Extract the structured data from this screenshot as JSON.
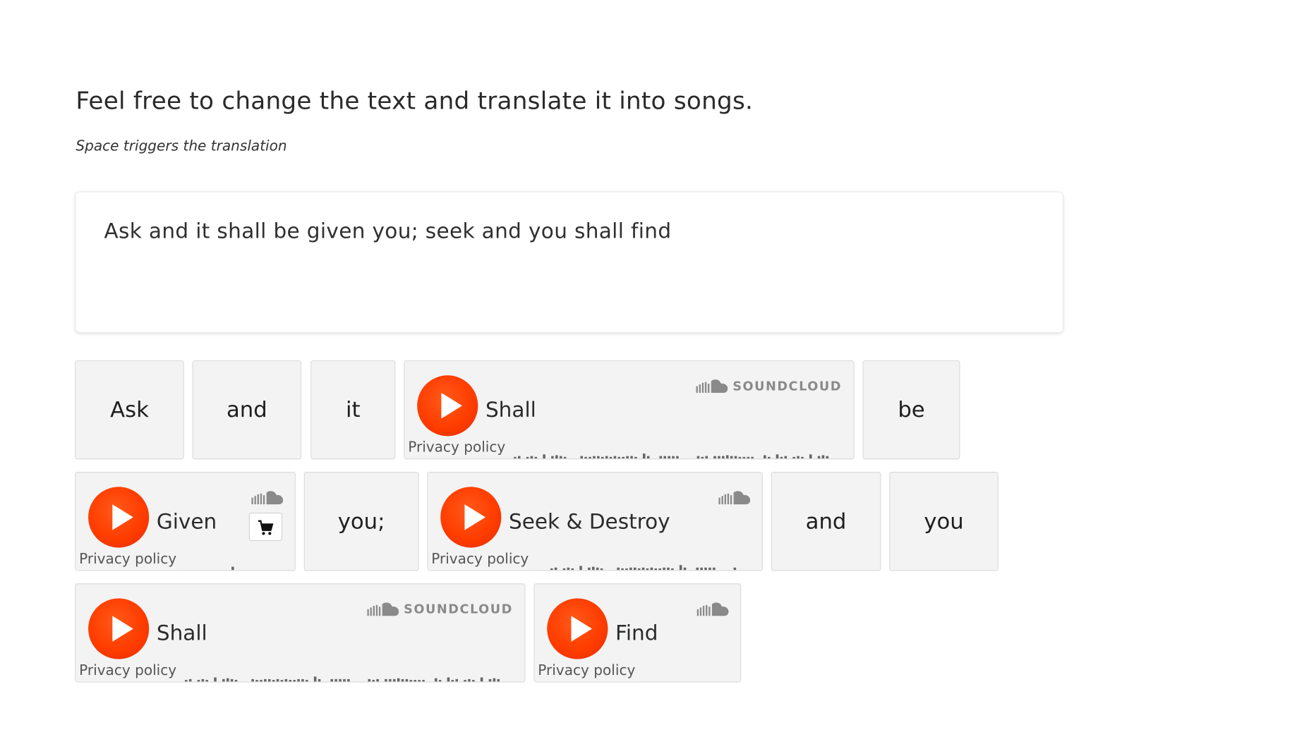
{
  "heading": "Feel free to change the text and translate it into songs.",
  "hint": "Space triggers the translation",
  "editor_text": "Ask and it shall be given you; seek and you shall find",
  "words": {
    "ask": "Ask",
    "and_1": "and",
    "it": "it",
    "be": "be",
    "you_semicolon": "you;",
    "and_2": "and",
    "you": "you"
  },
  "players": {
    "shall_1": {
      "title": "Shall",
      "privacy": "Privacy policy",
      "brand": "SOUNDCLOUD"
    },
    "given": {
      "title": "Given",
      "privacy": "Privacy policy"
    },
    "seek_destroy": {
      "title": "Seek & Destroy",
      "privacy": "Privacy policy"
    },
    "shall_2": {
      "title": "Shall",
      "privacy": "Privacy policy",
      "brand": "SOUNDCLOUD"
    },
    "find": {
      "title": "Find",
      "privacy": "Privacy policy"
    }
  },
  "colors": {
    "accent": "#ff3d00",
    "tile_bg": "#f3f3f3",
    "waveform": "#666666"
  },
  "icons": [
    "play-icon",
    "soundcloud-icon",
    "cart-icon"
  ]
}
